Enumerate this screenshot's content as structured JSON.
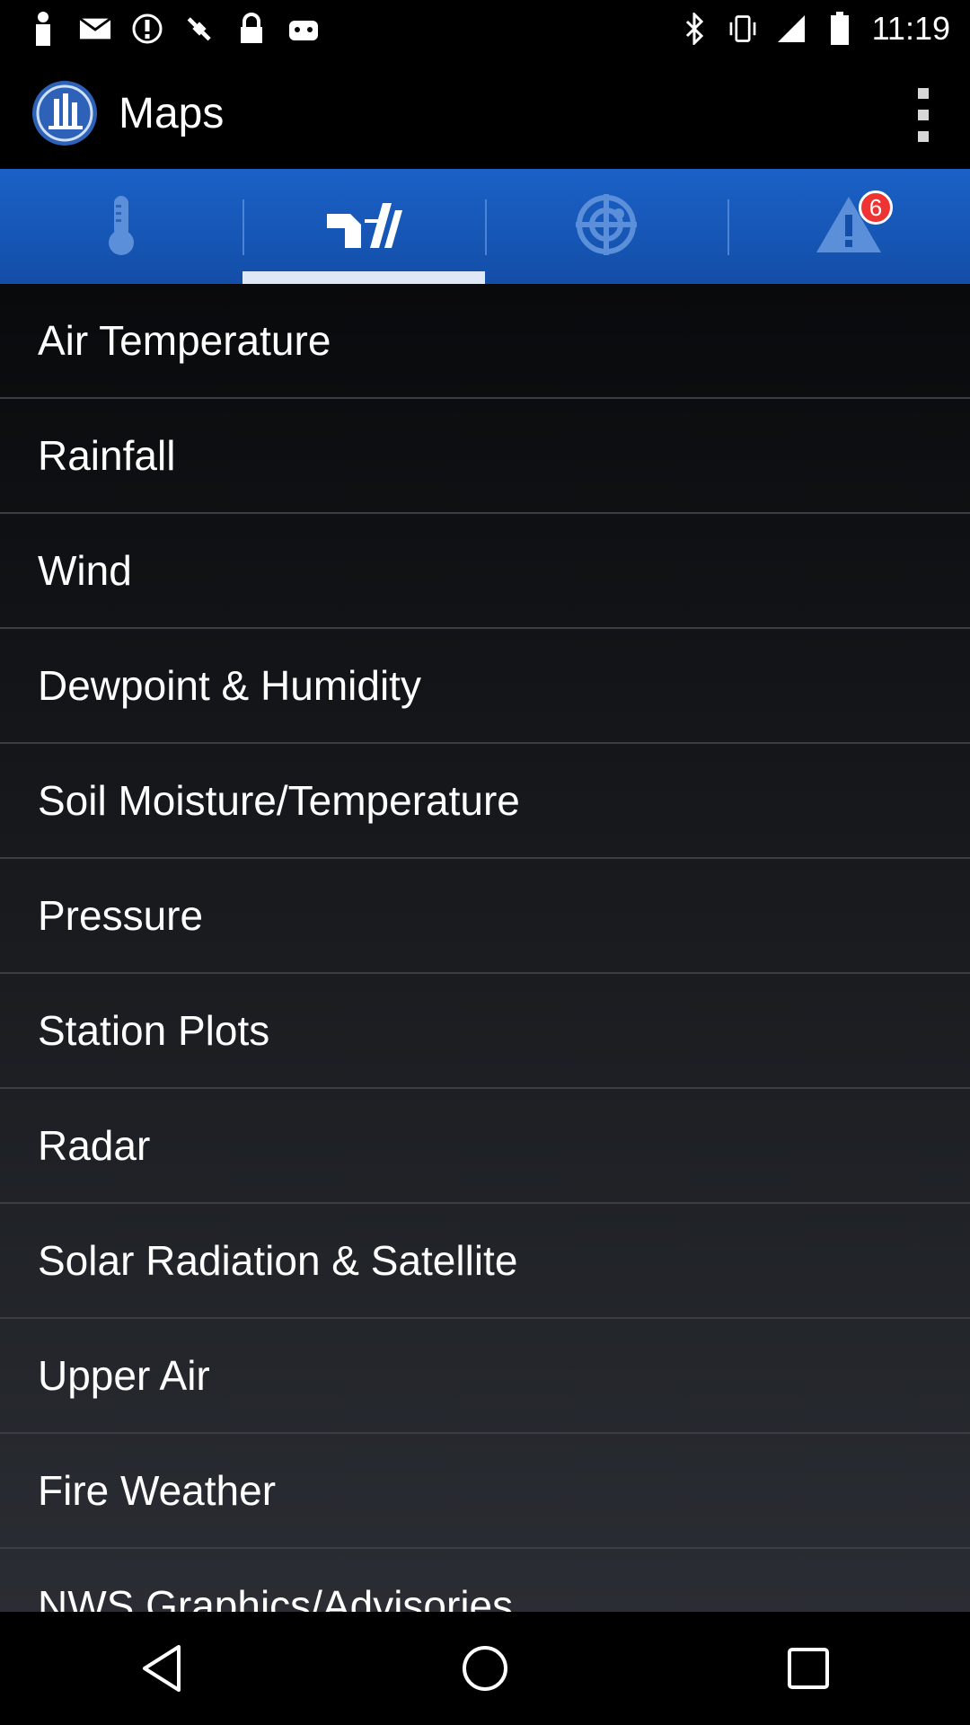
{
  "status_bar": {
    "time": "11:19",
    "icons": [
      "person-icon",
      "mail-icon",
      "alert-circle-icon",
      "fake-gps-icon",
      "lock-icon",
      "android-icon",
      "bluetooth-icon",
      "vibrate-icon",
      "signal-icon",
      "battery-icon"
    ]
  },
  "app_bar": {
    "title": "Maps",
    "logo": "app-logo-icon",
    "overflow": "more-vert-icon"
  },
  "tabs": [
    {
      "icon": "thermometer-icon",
      "active": false
    },
    {
      "icon": "maps-icon",
      "active": true
    },
    {
      "icon": "radar-icon",
      "active": false
    },
    {
      "icon": "warning-icon",
      "active": false,
      "badge": "6"
    }
  ],
  "menu": {
    "items": [
      {
        "label": "Air Temperature"
      },
      {
        "label": "Rainfall"
      },
      {
        "label": "Wind"
      },
      {
        "label": "Dewpoint & Humidity"
      },
      {
        "label": "Soil Moisture/Temperature"
      },
      {
        "label": "Pressure"
      },
      {
        "label": "Station Plots"
      },
      {
        "label": "Radar"
      },
      {
        "label": "Solar Radiation & Satellite"
      },
      {
        "label": "Upper Air"
      },
      {
        "label": "Fire Weather"
      },
      {
        "label": "NWS Graphics/Advisories"
      }
    ]
  },
  "nav_bar": {
    "icons": [
      "back-icon",
      "home-icon",
      "recents-icon"
    ]
  },
  "colors": {
    "tab_bar": "#1b61c7",
    "active_indicator": "#dfe8f6",
    "badge": "#ee3333",
    "divider": "#3a3d42"
  }
}
